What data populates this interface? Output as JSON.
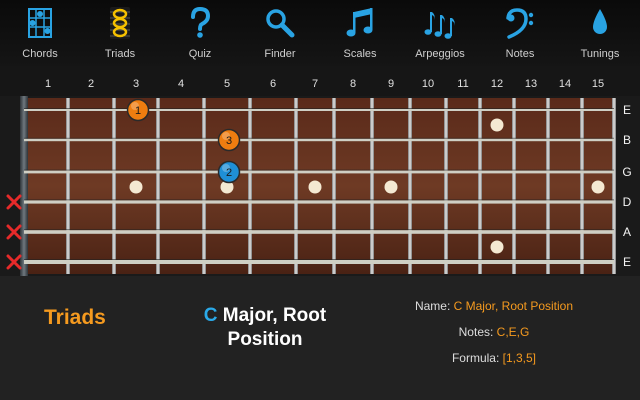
{
  "toolbar": {
    "items": [
      {
        "label": "Chords",
        "icon": "chord-diagram-icon"
      },
      {
        "label": "Triads",
        "icon": "triad-notes-icon"
      },
      {
        "label": "Quiz",
        "icon": "question-mark-icon"
      },
      {
        "label": "Finder",
        "icon": "magnifier-icon"
      },
      {
        "label": "Scales",
        "icon": "beamed-notes-icon"
      },
      {
        "label": "Arpeggios",
        "icon": "triple-notes-icon"
      },
      {
        "label": "Notes",
        "icon": "bass-clef-icon"
      },
      {
        "label": "Tunings",
        "icon": "drop-icon"
      }
    ]
  },
  "fret_numbers": [
    "1",
    "2",
    "3",
    "4",
    "5",
    "6",
    "7",
    "8",
    "9",
    "10",
    "11",
    "12",
    "13",
    "14",
    "15"
  ],
  "strings": [
    "E",
    "B",
    "G",
    "D",
    "A",
    "E"
  ],
  "muted_strings": [
    3,
    4,
    5
  ],
  "inlays": [
    {
      "fret": 3,
      "string_gap": 3
    },
    {
      "fret": 5,
      "string_gap": 3
    },
    {
      "fret": 7,
      "string_gap": 3
    },
    {
      "fret": 9,
      "string_gap": 3
    },
    {
      "fret": 12,
      "string_gap": 1
    },
    {
      "fret": 12,
      "string_gap": 5
    },
    {
      "fret": 15,
      "string_gap": 3
    }
  ],
  "markers": [
    {
      "fret": 3,
      "string": 0,
      "label": "1",
      "color": "#ee7d10"
    },
    {
      "fret": 5,
      "string": 1,
      "label": "3",
      "color": "#ee7d10"
    },
    {
      "fret": 5,
      "string": 2,
      "label": "2",
      "color": "#1f8fd6"
    }
  ],
  "colors": {
    "accent": "#f59a1f",
    "root": "#2aa9e8",
    "icon": "#29a3e3"
  },
  "panel": {
    "title": "Triads",
    "chord_root": "C",
    "chord_rest": " Major, Root Position",
    "name_label": "Name:",
    "name_value": "C Major, Root Position",
    "notes_label": "Notes:",
    "notes_value": "C,E,G",
    "formula_label": "Formula:",
    "formula_value": "[1,3,5]"
  }
}
